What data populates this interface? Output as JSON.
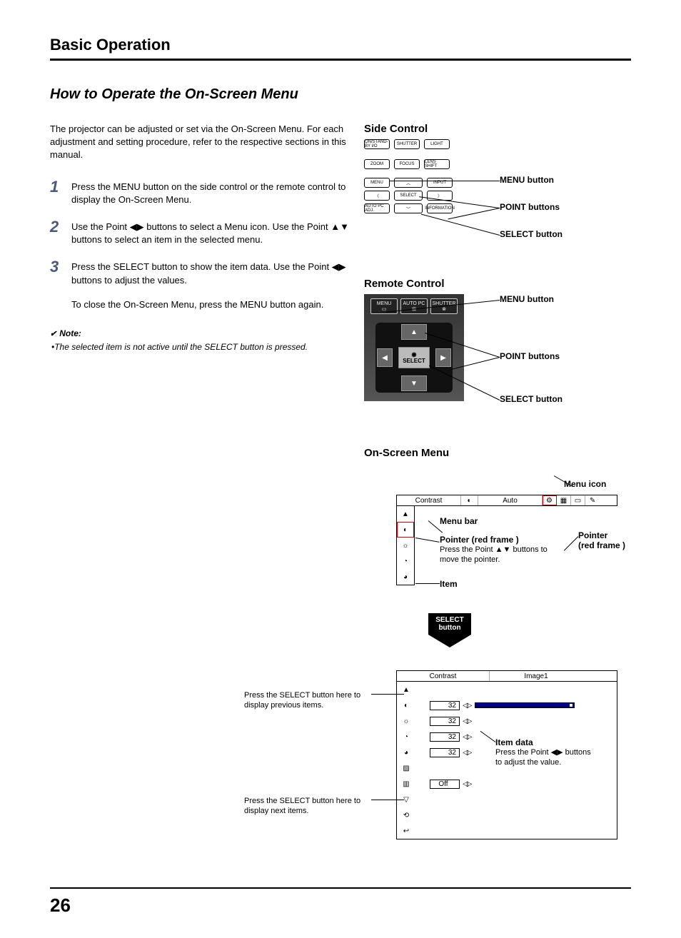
{
  "header": {
    "title": "Basic Operation"
  },
  "section": {
    "title": "How to Operate the On-Screen Menu"
  },
  "intro": "The projector can be adjusted or set via the On-Screen Menu. For each adjustment and setting procedure, refer to the respective sections in this manual.",
  "steps": [
    {
      "num": "1",
      "text": "Press the MENU button on the side control or the remote control to display the On-Screen Menu."
    },
    {
      "num": "2",
      "text": "Use the Point ◀▶ buttons to select a Menu icon. Use the Point ▲▼ buttons to select an item in the selected menu."
    },
    {
      "num": "3",
      "text": "Press the SELECT button to show the item data. Use the Point ◀▶ buttons to adjust the values."
    }
  ],
  "closing": "To close the On-Screen Menu, press the MENU button again.",
  "note": {
    "head": "Note:",
    "body": "•The selected item is not active until the SELECT button is pressed."
  },
  "side_control": {
    "head": "Side Control",
    "buttons": {
      "r1": [
        "ON/STAND-BY I/O",
        "SHUTTER",
        "LIGHT"
      ],
      "r2": [
        "ZOOM",
        "FOCUS",
        "LENS SHIFT"
      ],
      "r3": [
        "MENU",
        "",
        "INPUT"
      ],
      "r4": [
        "",
        "SELECT",
        ""
      ],
      "r5": [
        "AUTO PC ADJ.",
        "",
        "INFORMATION"
      ]
    },
    "callouts": {
      "menu": "MENU button",
      "point": "POINT buttons",
      "select": "SELECT button"
    }
  },
  "remote_control": {
    "head": "Remote Control",
    "top_buttons": [
      "MENU",
      "AUTO PC",
      "SHUTTER"
    ],
    "select_label": "SELECT",
    "callouts": {
      "menu": "MENU button",
      "point": "POINT buttons",
      "select": "SELECT button"
    }
  },
  "osm": {
    "head": "On-Screen Menu",
    "menu_icon_label": "Menu icon",
    "menu_bar_label": "Menu bar",
    "pointer_label": "Pointer (red frame )",
    "pointer_desc": "Press the Point ▲▼ buttons to move the pointer.",
    "pointer_right_label": "Pointer",
    "pointer_right_sub": "(red frame )",
    "item_label": "Item",
    "select_button_label1": "SELECT",
    "select_button_label2": "button",
    "top_menu": {
      "left": "Contrast",
      "icon": "◐",
      "right": "Auto"
    },
    "bottom_menu": {
      "left": "Contrast",
      "right": "Image1"
    },
    "left_note1": "Press the SELECT button here to display previous items.",
    "left_note2": "Press the SELECT button here to display next items.",
    "item_data_label": "Item data",
    "item_data_desc": "Press the Point ◀▶ buttons to adjust the value.",
    "rows": [
      {
        "icon": "▲",
        "val": ""
      },
      {
        "icon": "◐",
        "val": "32"
      },
      {
        "icon": "☼",
        "val": "32"
      },
      {
        "icon": "◔",
        "val": "32"
      },
      {
        "icon": "◕",
        "val": "32"
      },
      {
        "icon": "▨",
        "val": ""
      },
      {
        "icon": "▥",
        "val": "Off"
      },
      {
        "icon": "▽",
        "val": ""
      },
      {
        "icon": "⟲",
        "val": ""
      },
      {
        "icon": "↩",
        "val": ""
      }
    ]
  },
  "page_number": "26"
}
